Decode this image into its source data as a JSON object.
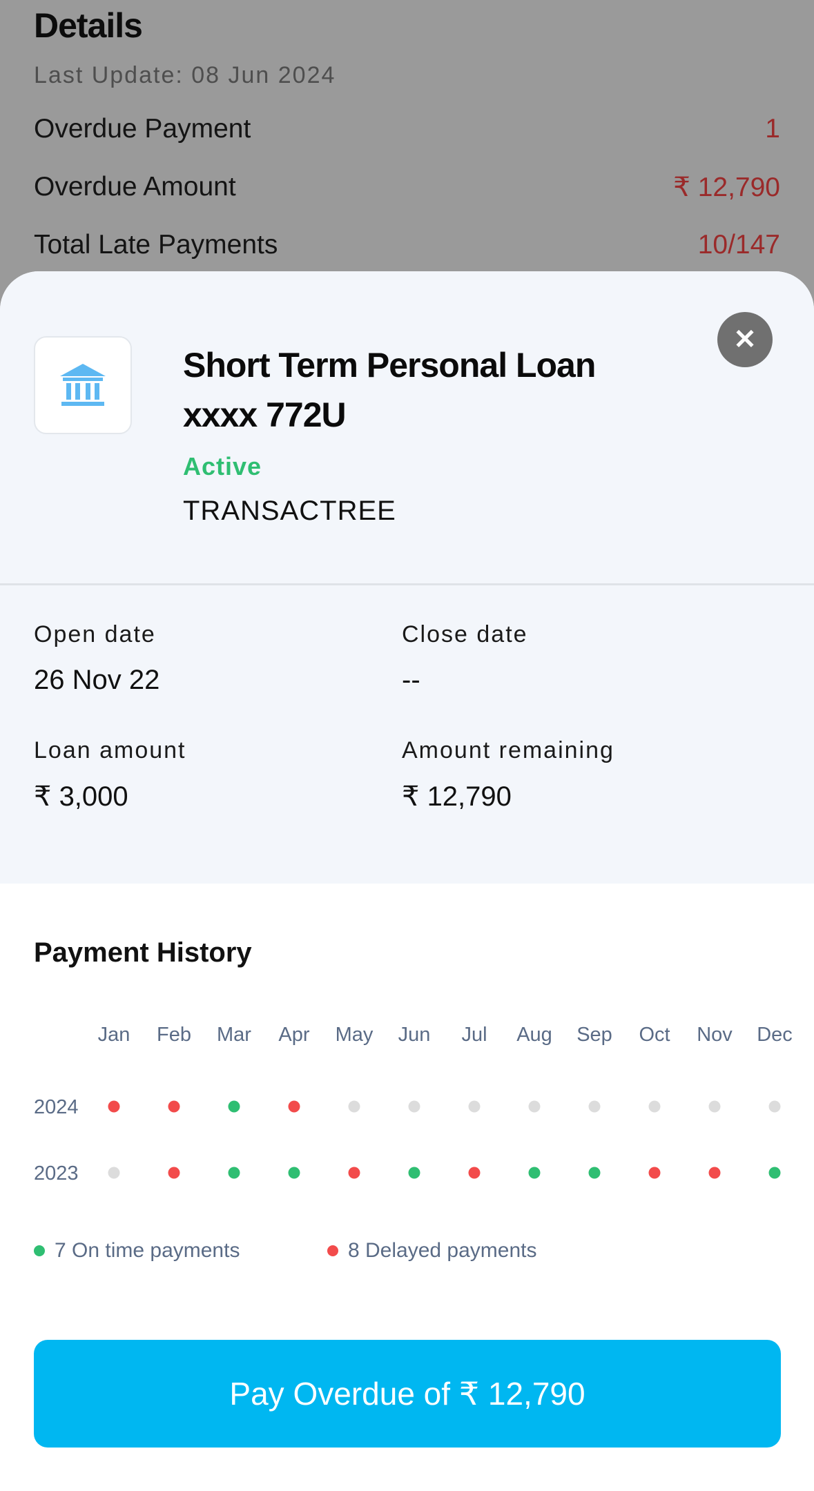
{
  "background": {
    "title": "Details",
    "last_update": "Last Update: 08 Jun 2024",
    "rows": [
      {
        "label": "Overdue Payment",
        "value": "1"
      },
      {
        "label": "Overdue Amount",
        "value": "₹ 12,790"
      },
      {
        "label": "Total Late Payments",
        "value": "10/147"
      }
    ]
  },
  "sheet": {
    "close_icon": "close-icon",
    "logo_icon": "bank-icon",
    "loan_title_line1": "Short Term Personal Loan",
    "loan_title_line2": "xxxx 772U",
    "status": "Active",
    "lender": "TRANSACTREE",
    "fields": {
      "open_date_label": "Open date",
      "open_date_value": "26 Nov 22",
      "close_date_label": "Close date",
      "close_date_value": "--",
      "loan_amount_label": "Loan amount",
      "loan_amount_value": "₹ 3,000",
      "amount_remaining_label": "Amount remaining",
      "amount_remaining_value": "₹ 12,790"
    }
  },
  "payment_history": {
    "title": "Payment History",
    "legend_on_time": "7 On time payments",
    "legend_delayed": "8 Delayed payments"
  },
  "chart_data": {
    "type": "heatmap",
    "title": "Payment History",
    "months": [
      "Jan",
      "Feb",
      "Mar",
      "Apr",
      "May",
      "Jun",
      "Jul",
      "Aug",
      "Sep",
      "Oct",
      "Nov",
      "Dec"
    ],
    "rows": [
      {
        "year": "2024",
        "status": [
          "delayed",
          "delayed",
          "on_time",
          "delayed",
          "none",
          "none",
          "none",
          "none",
          "none",
          "none",
          "none",
          "none"
        ]
      },
      {
        "year": "2023",
        "status": [
          "none",
          "delayed",
          "on_time",
          "on_time",
          "delayed",
          "on_time",
          "delayed",
          "on_time",
          "on_time",
          "delayed",
          "delayed",
          "on_time"
        ]
      }
    ],
    "colors": {
      "on_time": "#2fbe72",
      "delayed": "#f24b4b",
      "none": "#dcdcdc"
    }
  },
  "pay_button": "Pay Overdue of ₹ 12,790",
  "colors": {
    "accent": "#00b7f1",
    "active": "#2fbe72",
    "overdue": "#9a2a2a"
  }
}
